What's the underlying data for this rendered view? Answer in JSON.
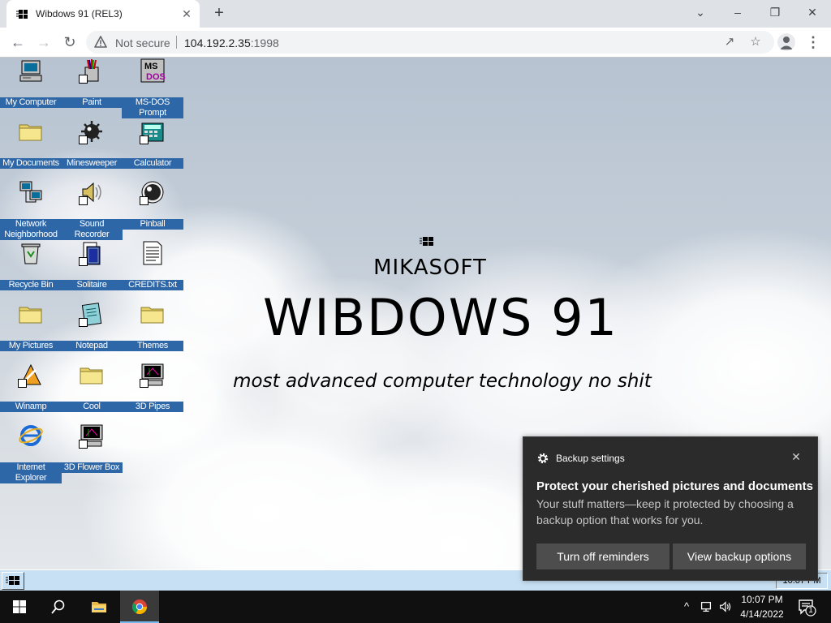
{
  "browser": {
    "tab_title": "Wibdows 91 (REL3)",
    "tab_close": "✕",
    "new_tab": "+",
    "security": "Not secure",
    "url_host": "104.192.2.35",
    "url_port": ":1998",
    "window_controls": {
      "collapse": "⌄",
      "minimize": "–",
      "restore": "❐",
      "close": "✕"
    }
  },
  "desktop": {
    "icons": [
      {
        "label": "My Computer",
        "icon": "my-computer-icon"
      },
      {
        "label": "Paint",
        "icon": "paint-icon"
      },
      {
        "label": "MS-DOS Prompt",
        "icon": "ms-dos-icon"
      },
      {
        "label": "My Documents",
        "icon": "folder-icon"
      },
      {
        "label": "Minesweeper",
        "icon": "minesweeper-icon"
      },
      {
        "label": "Calculator",
        "icon": "calculator-icon"
      },
      {
        "label": "Network Neighborhood",
        "icon": "network-icon"
      },
      {
        "label": "Sound Recorder",
        "icon": "sound-recorder-icon"
      },
      {
        "label": "Pinball",
        "icon": "pinball-icon"
      },
      {
        "label": "Recycle Bin",
        "icon": "recycle-bin-icon"
      },
      {
        "label": "Solitaire",
        "icon": "solitaire-icon"
      },
      {
        "label": "CREDITS.txt",
        "icon": "text-file-icon"
      },
      {
        "label": "My Pictures",
        "icon": "folder-icon"
      },
      {
        "label": "Notepad",
        "icon": "notepad-icon"
      },
      {
        "label": "Themes",
        "icon": "folder-icon"
      },
      {
        "label": "Winamp",
        "icon": "winamp-icon"
      },
      {
        "label": "Cool",
        "icon": "folder-icon"
      },
      {
        "label": "3D Pipes",
        "icon": "screensaver-icon"
      },
      {
        "label": "Internet Explorer",
        "icon": "internet-explorer-icon"
      },
      {
        "label": "3D Flower Box",
        "icon": "screensaver-icon"
      }
    ],
    "brand_small": "MIKASOFT",
    "brand_big": "WIBDOWS 91",
    "tagline": "most advanced computer technology no shit",
    "wib_clock": "10:07 PM"
  },
  "toast": {
    "app": "Backup settings",
    "close": "✕",
    "title": "Protect your cherished pictures and documents",
    "body": "Your stuff matters—keep it protected by choosing a backup option that works for you.",
    "btn_off": "Turn off reminders",
    "btn_view": "View backup options"
  },
  "taskbar": {
    "time": "10:07 PM",
    "date": "4/14/2022",
    "notification_count": "1",
    "tray_chevron": "^"
  },
  "colors": {
    "label_bg": "#2e67a8",
    "wib_taskbar": "#c7e0f3",
    "toast_bg": "#2b2b2b",
    "toast_button": "#4d4d4d",
    "taskbar_bg": "#101010"
  }
}
